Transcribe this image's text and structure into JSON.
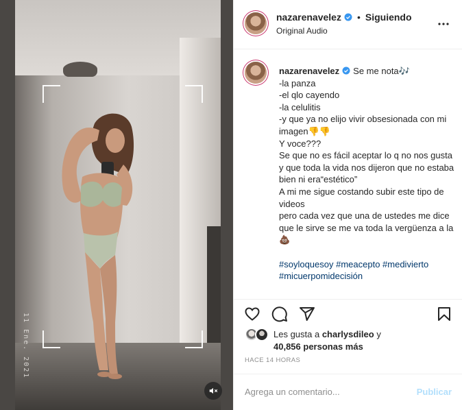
{
  "header": {
    "username": "nazarenavelez",
    "separator": "•",
    "follow_status": "Siguiendo",
    "audio": "Original Audio",
    "verified_icon": "verified-badge-icon",
    "more_icon": "more-options-icon"
  },
  "video": {
    "date_stamp": "11 Ene. 2021",
    "mute_icon": "muted-speaker-icon"
  },
  "caption": {
    "username": "nazarenavelez",
    "text": "Se me nota🎶\n-la panza\n-el qlo cayendo\n-la celulitis\n-y que ya no elijo vivir obsesionada con mi imagen👎👎\nY voce???\nSe que no es fácil aceptar lo q no nos gusta y que toda la vida nos dijeron que no estaba bien ni era“estético”\nA mi me sigue costando subir este tipo de videos\npero cada vez que una de ustedes me dice que le sirve se me va toda la vergüenza a la 💩",
    "hashtags": "#soyloquesoy #meacepto #medivierto #micuerpomidecisión"
  },
  "actions": {
    "like_icon": "heart-icon",
    "comment_icon": "comment-bubble-icon",
    "share_icon": "paper-plane-icon",
    "save_icon": "bookmark-icon"
  },
  "likes": {
    "prefix": "Les gusta a ",
    "first_user": "charlysdileo",
    "middle": " y ",
    "count_text": "40,856 personas más"
  },
  "timestamp": "HACE 14 HORAS",
  "comment": {
    "placeholder": "Agrega un comentario...",
    "publish_label": "Publicar"
  },
  "colors": {
    "link_blue": "#00376b",
    "publish_disabled": "#b2dffc",
    "verified_blue": "#3897f0",
    "muted_text": "#8e8e8e",
    "border": "#efefef"
  }
}
